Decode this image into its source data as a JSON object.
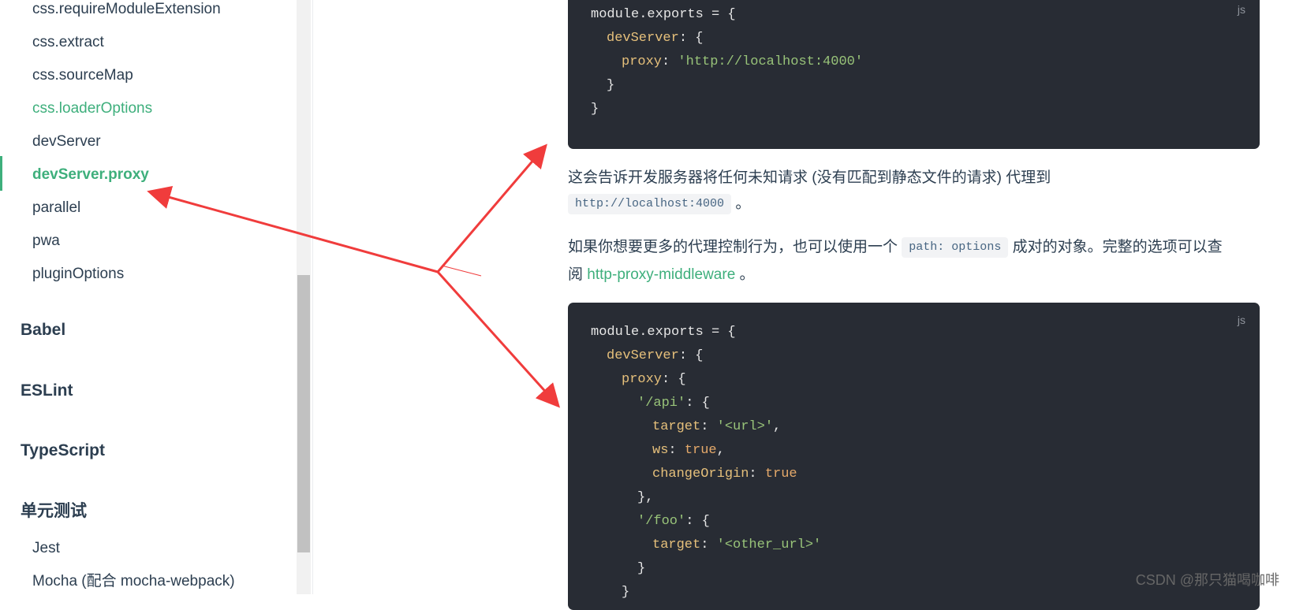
{
  "sidebar": {
    "items": [
      {
        "label": "css.requireModuleExtension"
      },
      {
        "label": "css.extract"
      },
      {
        "label": "css.sourceMap"
      },
      {
        "label": "css.loaderOptions"
      },
      {
        "label": "devServer"
      },
      {
        "label": "devServer.proxy"
      },
      {
        "label": "parallel"
      },
      {
        "label": "pwa"
      },
      {
        "label": "pluginOptions"
      }
    ],
    "groups": [
      {
        "label": "Babel"
      },
      {
        "label": "ESLint"
      },
      {
        "label": "TypeScript"
      },
      {
        "label": "单元测试"
      }
    ],
    "sub_items": [
      {
        "label": "Jest"
      },
      {
        "label": "Mocha (配合 mocha-webpack)"
      }
    ]
  },
  "code1": {
    "lang": "js",
    "l1": "module.exports = {",
    "l2_key": "devServer",
    "l2_rest": ": {",
    "l3_key": "proxy",
    "l3_colon": ": ",
    "l3_val": "'http://localhost:4000'",
    "l4": "}",
    "l5": "}"
  },
  "para1": {
    "text": "这会告诉开发服务器将任何未知请求 (没有匹配到静态文件的请求) 代理到",
    "code": "http://localhost:4000",
    "end": "。"
  },
  "para2": {
    "before": "如果你想要更多的代理控制行为，也可以使用一个",
    "code": "path: options",
    "after": "成对的对象。完整的选项可以查",
    "line2_prefix": "阅",
    "link": "http-proxy-middleware",
    "end": "。"
  },
  "code2": {
    "lang": "js",
    "l1": "module.exports = {",
    "l2_key": "devServer",
    "l2_rest": ": {",
    "l3_key": "proxy",
    "l3_rest": ": {",
    "l4_key": "'/api'",
    "l4_rest": ": {",
    "l5_key": "target",
    "l5_colon": ": ",
    "l5_val": "'<url>'",
    "l5_end": ",",
    "l6_key": "ws",
    "l6_colon": ": ",
    "l6_val": "true",
    "l6_end": ",",
    "l7_key": "changeOrigin",
    "l7_colon": ": ",
    "l7_val": "true",
    "l8": "},",
    "l9_key": "'/foo'",
    "l9_rest": ": {",
    "l10_key": "target",
    "l10_colon": ": ",
    "l10_val": "'<other_url>'",
    "l11": "}",
    "l12": "}"
  },
  "watermark": "CSDN @那只猫喝咖啡",
  "colors": {
    "accent": "#3eaf7c",
    "arrow": "#f03c3c",
    "code_bg": "#282c34"
  }
}
